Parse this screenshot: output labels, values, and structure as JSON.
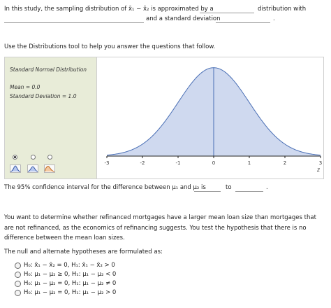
{
  "question1": {
    "prefix": "In this study, the sampling distribution of x̄₁ − x̄₂ is approximated by a",
    "suffix": "distribution with",
    "line2": "and a standard deviation",
    "period": "."
  },
  "instruction": "Use the Distributions tool to help you answer the questions that follow.",
  "tool": {
    "title": "Standard Normal Distribution",
    "mean_label": "Mean = 0.0",
    "sd_label": "Standard Deviation = 1.0",
    "selected_radio_index": 0,
    "dist_icons": [
      "normal-dist-icon",
      "t-dist-icon",
      "chi-square-dist-icon"
    ],
    "fill_color": "#cfd9ef",
    "curve_color": "#4a6fb5"
  },
  "chart_data": {
    "type": "area",
    "x": [
      -3,
      -2.5,
      -2,
      -1.5,
      -1,
      -0.5,
      0,
      0.5,
      1,
      1.5,
      2,
      2.5,
      3
    ],
    "y": [
      0.0044,
      0.0175,
      0.054,
      0.1295,
      0.242,
      0.3521,
      0.3989,
      0.3521,
      0.242,
      0.1295,
      0.054,
      0.0175,
      0.0044
    ],
    "xticks": [
      "-3",
      "-2",
      "-1",
      "0",
      "1",
      "2",
      "3"
    ],
    "xlabel": "z",
    "xlim": [
      -3,
      3
    ],
    "ylim": [
      0,
      0.42
    ],
    "vertical_line_x": 0
  },
  "ci": {
    "prefix": "The 95% confidence interval for the difference between μ₁ and μ₂ is",
    "to": "to",
    "period": "."
  },
  "scenario": "You want to determine whether refinanced mortgages have a larger mean loan size than mortgages that are not refinanced, as the economics of refinancing suggests. You test the hypothesis that there is no difference between the mean loan sizes.",
  "hypotheses": {
    "prompt": "The null and alternate hypotheses are formulated as:",
    "options": [
      "H₀: x̄₁ − x̄₂ = 0, H₁: x̄₁ − x̄₂ > 0",
      "H₀: μ₁ − μ₂ ≥ 0, H₁: μ₁ − μ₂ < 0",
      "H₀: μ₁ − μ₂ = 0, H₁: μ₁ − μ₂ ≠ 0",
      "H₀: μ₁ − μ₂ = 0, H₁: μ₁ − μ₂ > 0"
    ]
  }
}
